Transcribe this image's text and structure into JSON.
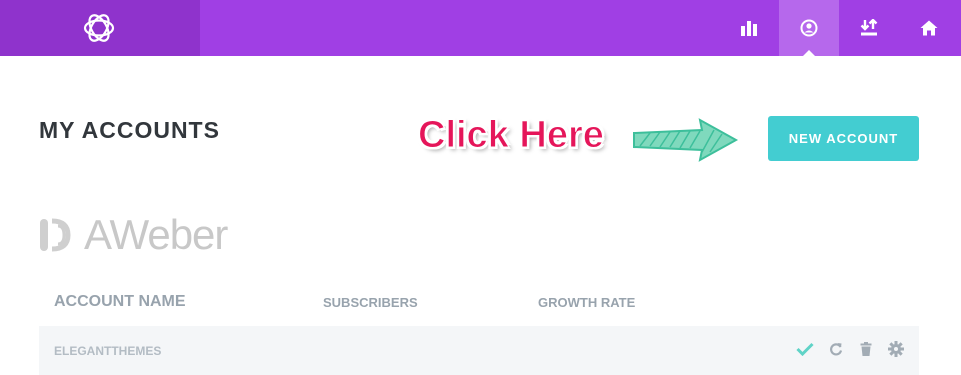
{
  "header": {
    "logo_icon": "bloom-logo-icon",
    "nav_icons": [
      "stats-icon",
      "accounts-icon",
      "import-export-icon",
      "home-icon"
    ],
    "active_nav": "accounts-icon",
    "colors": {
      "bar": "#a03fe4",
      "logo_block": "#8f33cc",
      "active": "#b668ec"
    }
  },
  "page": {
    "title": "MY ACCOUNTS",
    "new_account_label": "NEW ACCOUNT",
    "button_color": "#43cdd1"
  },
  "annotation": {
    "text": "Click Here",
    "color": "#e5165a",
    "arrow_icon": "arrow-right-icon",
    "arrow_color": "#3dbf9b"
  },
  "provider": {
    "name": "AWeber",
    "icon": "aweber-logo-icon"
  },
  "table": {
    "columns": [
      "ACCOUNT NAME",
      "SUBSCRIBERS",
      "GROWTH RATE"
    ],
    "rows": [
      {
        "name": "ELEGANTTHEMES",
        "actions": [
          "check-icon",
          "refresh-icon",
          "delete-icon",
          "settings-icon"
        ]
      }
    ]
  }
}
